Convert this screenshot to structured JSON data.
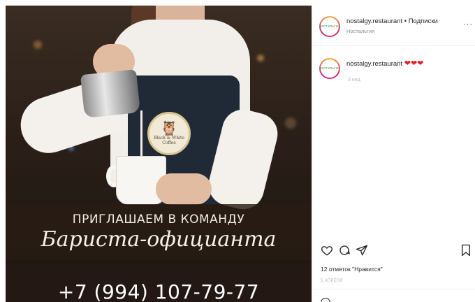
{
  "photo": {
    "badge_text": "Black & White Coffee",
    "invite_text": "ПРИГЛАШАЕМ В КОМАНДУ",
    "role_text": "Бариста-официанта",
    "phone_text": "+7 (994) 107-79-77"
  },
  "post": {
    "username": "nostalgy.restaurant",
    "separator": "•",
    "follow_label": "Подписки",
    "subtitle": "Ностальгия",
    "more_label": "···",
    "avatar_text": "ностальгия"
  },
  "caption": {
    "username": "nostalgy.restaurant",
    "hearts": "❤❤❤",
    "time": "3 нед."
  },
  "footer": {
    "likes": "12 отметок \"Нравится\"",
    "date": "5 АПРЕЛЯ"
  },
  "icons": {
    "like": "heart-outline",
    "comment": "comment-bubble",
    "share": "paper-plane",
    "save": "bookmark"
  }
}
